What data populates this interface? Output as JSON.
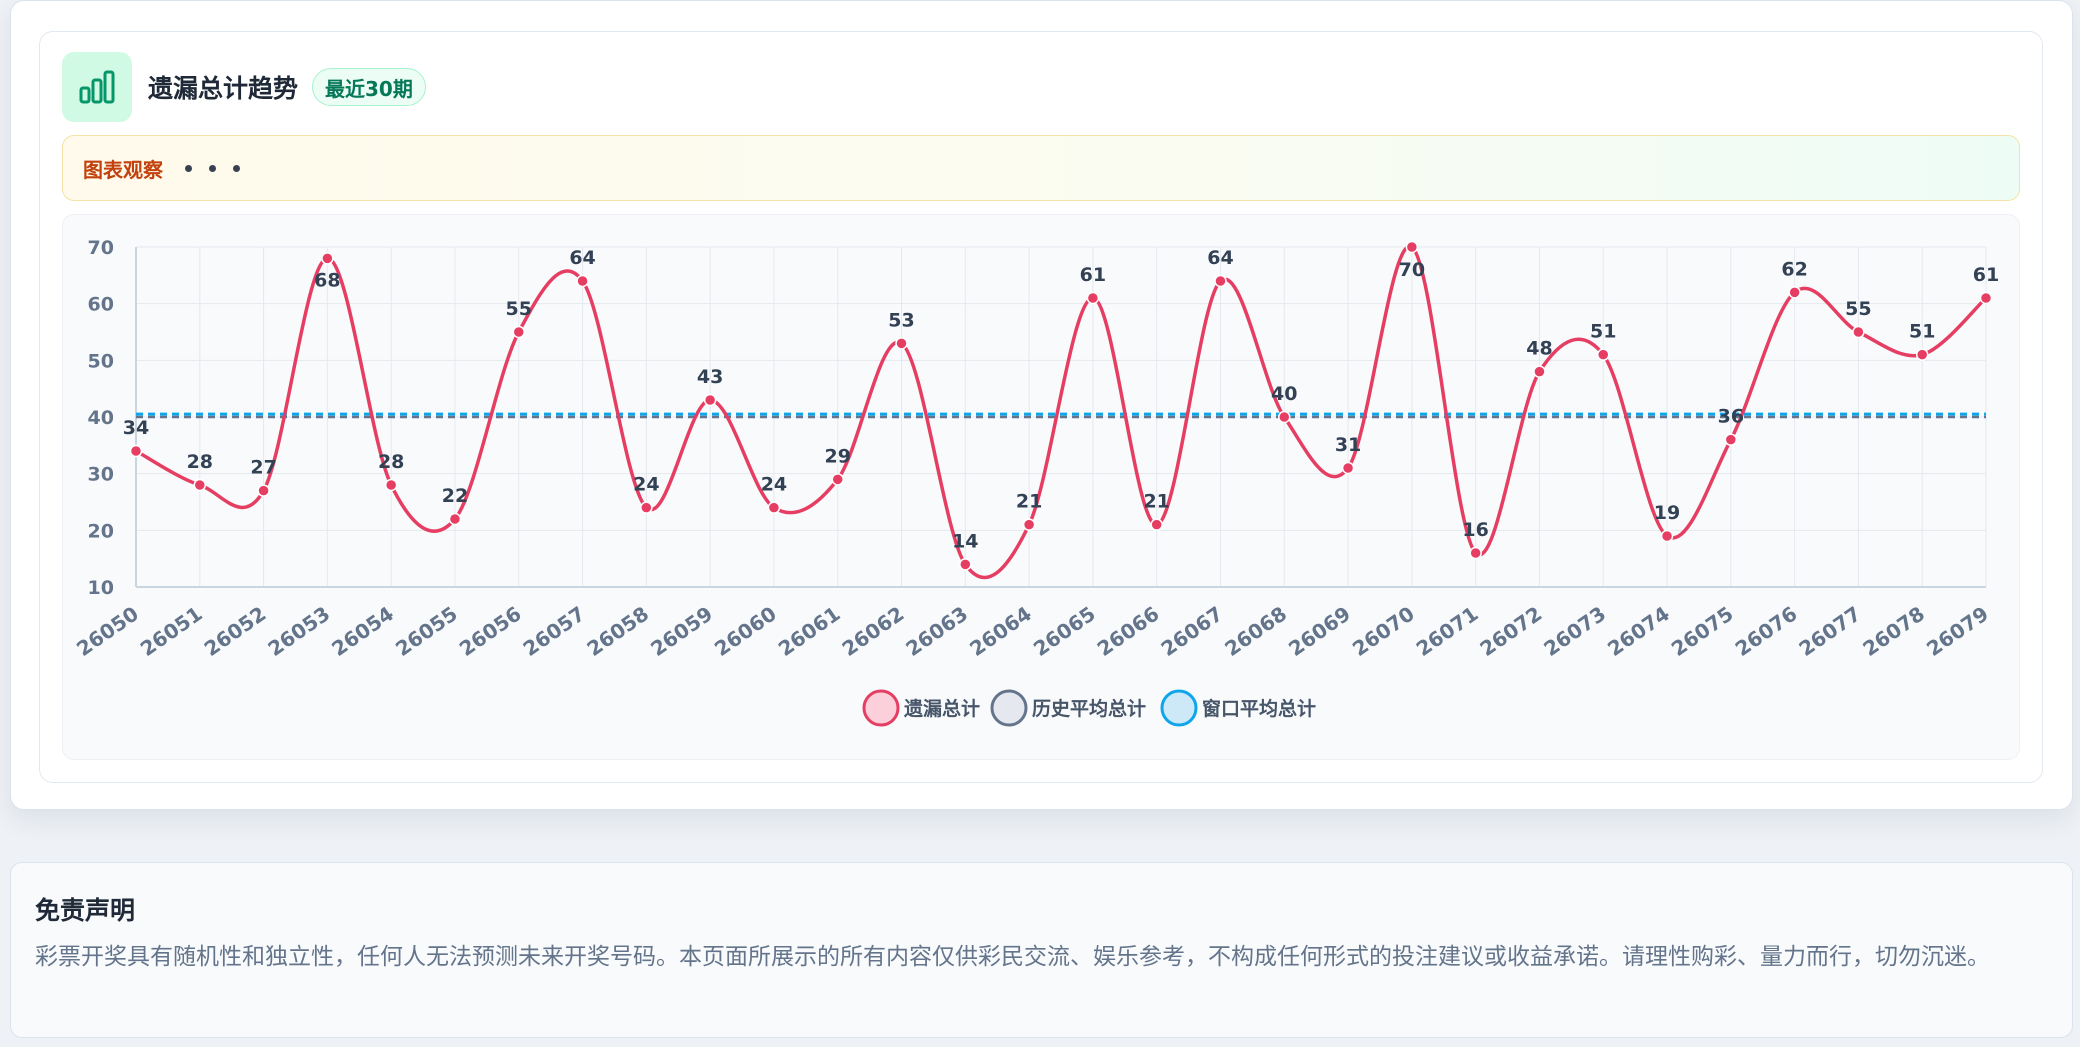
{
  "header": {
    "title": "遗漏总计趋势",
    "badge": "最近30期",
    "icon": "bar-chart-icon",
    "accent_color": "#059669"
  },
  "observation": {
    "label": "图表观察",
    "dots_icon": "ellipsis-icon"
  },
  "chart_data": {
    "type": "line",
    "categories": [
      "26050",
      "26051",
      "26052",
      "26053",
      "26054",
      "26055",
      "26056",
      "26057",
      "26058",
      "26059",
      "26060",
      "26061",
      "26062",
      "26063",
      "26064",
      "26065",
      "26066",
      "26067",
      "26068",
      "26069",
      "26070",
      "26071",
      "26072",
      "26073",
      "26074",
      "26075",
      "26076",
      "26077",
      "26078",
      "26079"
    ],
    "series": [
      {
        "name": "遗漏总计",
        "color": "#e63e62",
        "values": [
          34,
          28,
          27,
          68,
          28,
          22,
          55,
          64,
          24,
          43,
          24,
          29,
          53,
          14,
          21,
          61,
          21,
          64,
          40,
          31,
          70,
          16,
          48,
          51,
          19,
          36,
          62,
          55,
          51,
          61
        ]
      },
      {
        "name": "历史平均总计",
        "color": "#64748b",
        "constant": 40
      },
      {
        "name": "窗口平均总计",
        "color": "#0ea5e9",
        "constant": 40.5
      }
    ],
    "yticks": [
      10,
      20,
      30,
      40,
      50,
      60,
      70
    ],
    "ylim": [
      10,
      70
    ],
    "grid": true,
    "legend_position": "bottom-center",
    "data_labels": true
  },
  "disclaimer": {
    "title": "免责声明",
    "text": "彩票开奖具有随机性和独立性，任何人无法预测未来开奖号码。本页面所展示的所有内容仅供彩民交流、娱乐参考，不构成任何形式的投注建议或收益承诺。请理性购彩、量力而行，切勿沉迷。"
  }
}
